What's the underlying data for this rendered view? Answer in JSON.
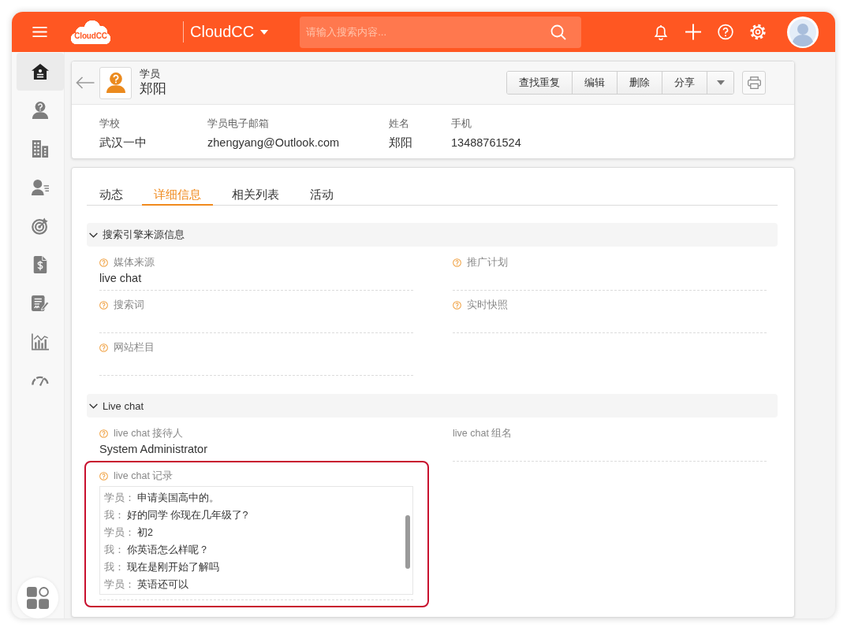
{
  "top_bar": {
    "logo": "CloudCC",
    "app_switcher": "CloudCC",
    "search": {
      "placeholder": "请输入搜索内容..."
    }
  },
  "sidebar": {
    "items": [
      {
        "kind": "house",
        "selected": true
      },
      {
        "kind": "person",
        "selected": false
      },
      {
        "kind": "buildings",
        "selected": false
      },
      {
        "kind": "contacts",
        "selected": false
      },
      {
        "kind": "target",
        "selected": false
      },
      {
        "kind": "invoice",
        "selected": false
      },
      {
        "kind": "contract",
        "selected": false
      },
      {
        "kind": "chart",
        "selected": false
      },
      {
        "kind": "gauge",
        "selected": false
      }
    ]
  },
  "record": {
    "object_type": "学员",
    "name": "郑阳",
    "actions": [
      "查找重复",
      "编辑",
      "删除",
      "分享"
    ],
    "summary": [
      {
        "label": "学校",
        "value": "武汉一中"
      },
      {
        "label": "学员电子邮箱",
        "value": "zhengyang@Outlook.com"
      },
      {
        "label": "姓名",
        "value": "郑阳"
      },
      {
        "label": "手机",
        "value": "13488761524"
      }
    ]
  },
  "tabs": [
    {
      "label": "动态",
      "selected": false
    },
    {
      "label": "详细信息",
      "selected": true
    },
    {
      "label": "相关列表",
      "selected": false
    },
    {
      "label": "活动",
      "selected": false
    }
  ],
  "sections": [
    {
      "title": "搜索引擎来源信息",
      "expanded": true,
      "fields": [
        {
          "kind": "text",
          "label": "媒体来源",
          "value": "live chat",
          "help": true,
          "highlighted": false
        },
        {
          "kind": "text",
          "label": "推广计划",
          "help": true,
          "highlighted": false
        },
        {
          "kind": "text",
          "label": "搜索词",
          "help": true,
          "highlighted": false
        },
        {
          "kind": "text",
          "label": "实时快照",
          "help": true,
          "highlighted": false
        },
        {
          "kind": "text",
          "label": "网站栏目",
          "help": true,
          "highlighted": false
        }
      ]
    },
    {
      "title": "Live chat",
      "expanded": true,
      "fields": [
        {
          "kind": "text",
          "label": "live chat 接待人",
          "value": "System Administrator",
          "help": true,
          "highlighted": false
        },
        {
          "kind": "text",
          "label": "live chat 组名",
          "help": false,
          "highlighted": false
        },
        {
          "kind": "chat",
          "label": "live chat 记录",
          "help": true,
          "highlighted": true,
          "messages": [
            {
              "speaker": "学员：",
              "text": "申请美国高中的。"
            },
            {
              "speaker": "我：",
              "text": "好的同学 你现在几年级了?"
            },
            {
              "speaker": "学员：",
              "text": "初2"
            },
            {
              "speaker": "我：",
              "text": "你英语怎么样呢？"
            },
            {
              "speaker": "我：",
              "text": "现在是刚开始了解吗"
            },
            {
              "speaker": "学员：",
              "text": "英语还可以"
            }
          ]
        }
      ]
    }
  ]
}
